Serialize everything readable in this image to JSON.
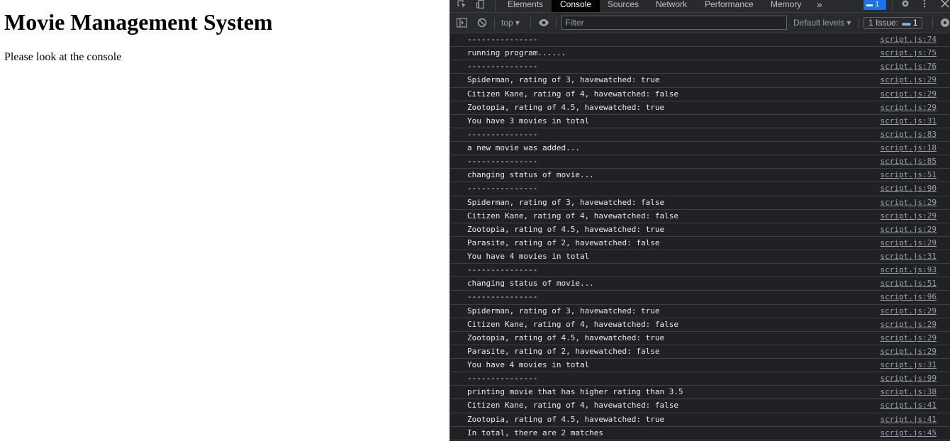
{
  "page": {
    "heading": "Movie Management System",
    "paragraph": "Please look at the console"
  },
  "devtools": {
    "tabs": [
      "Elements",
      "Console",
      "Sources",
      "Network",
      "Performance",
      "Memory"
    ],
    "active_tab": "Console",
    "more_tabs": "»",
    "messages_badge": "1",
    "toolbar": {
      "context": "top ▾",
      "filter_placeholder": "Filter",
      "levels": "Default levels ▾",
      "issues_label": "1 Issue:",
      "issues_count": "1"
    },
    "console_rows": [
      {
        "msg": "---------------",
        "src": "script.js:74"
      },
      {
        "msg": "running program......",
        "src": "script.js:75"
      },
      {
        "msg": "---------------",
        "src": "script.js:76"
      },
      {
        "msg": "Spiderman, rating of 3, havewatched: true",
        "src": "script.js:29"
      },
      {
        "msg": "Citizen Kane, rating of 4, havewatched: false",
        "src": "script.js:29"
      },
      {
        "msg": "Zootopia, rating of 4.5, havewatched: true",
        "src": "script.js:29"
      },
      {
        "msg": "You have 3 movies in total",
        "src": "script.js:31"
      },
      {
        "msg": "---------------",
        "src": "script.js:83"
      },
      {
        "msg": "a new movie was added...",
        "src": "script.js:18"
      },
      {
        "msg": "---------------",
        "src": "script.js:85"
      },
      {
        "msg": "changing status of movie...",
        "src": "script.js:51"
      },
      {
        "msg": "---------------",
        "src": "script.js:90"
      },
      {
        "msg": "Spiderman, rating of 3, havewatched: false",
        "src": "script.js:29"
      },
      {
        "msg": "Citizen Kane, rating of 4, havewatched: false",
        "src": "script.js:29"
      },
      {
        "msg": "Zootopia, rating of 4.5, havewatched: true",
        "src": "script.js:29"
      },
      {
        "msg": "Parasite, rating of 2, havewatched: false",
        "src": "script.js:29"
      },
      {
        "msg": "You have 4 movies in total",
        "src": "script.js:31"
      },
      {
        "msg": "---------------",
        "src": "script.js:93"
      },
      {
        "msg": "changing status of movie...",
        "src": "script.js:51"
      },
      {
        "msg": "---------------",
        "src": "script.js:96"
      },
      {
        "msg": "Spiderman, rating of 3, havewatched: true",
        "src": "script.js:29"
      },
      {
        "msg": "Citizen Kane, rating of 4, havewatched: false",
        "src": "script.js:29"
      },
      {
        "msg": "Zootopia, rating of 4.5, havewatched: true",
        "src": "script.js:29"
      },
      {
        "msg": "Parasite, rating of 2, havewatched: false",
        "src": "script.js:29"
      },
      {
        "msg": "You have 4 movies in total",
        "src": "script.js:31"
      },
      {
        "msg": "---------------",
        "src": "script.js:99"
      },
      {
        "msg": "printing movie that has higher rating than 3.5",
        "src": "script.js:38"
      },
      {
        "msg": "Citizen Kane, rating of 4, havewatched: false",
        "src": "script.js:41"
      },
      {
        "msg": "Zootopia, rating of 4.5, havewatched: true",
        "src": "script.js:41"
      },
      {
        "msg": "In total, there are 2 matches",
        "src": "script.js:45"
      }
    ]
  }
}
